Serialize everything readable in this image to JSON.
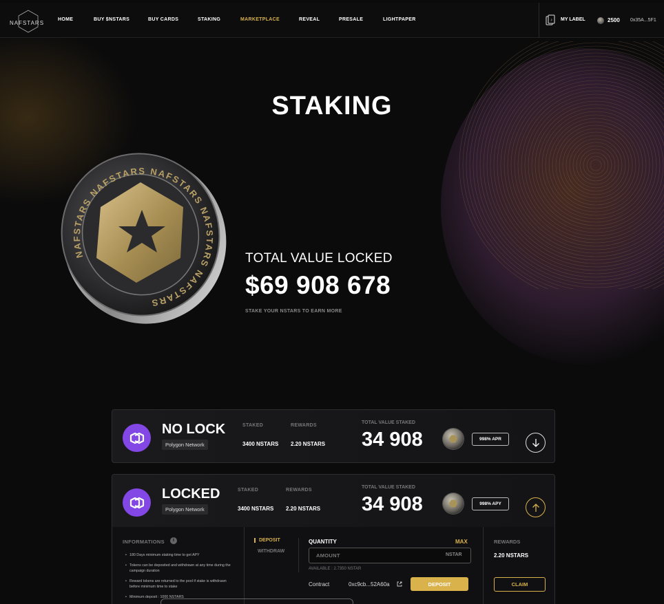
{
  "brand": {
    "logo_text": "NAFSTARS"
  },
  "nav": {
    "items": [
      "HOME",
      "BUY $NSTARS",
      "BUY CARDS",
      "STAKING",
      "MARKETPLACE",
      "REVEAL",
      "PRESALE",
      "LIGHTPAPER"
    ],
    "active": "MARKETPLACE",
    "my_label": "MY LABEL",
    "balance": "2500",
    "wallet": "0x35A...5F1"
  },
  "hero": {
    "title": "STAKING",
    "tvl_label": "TOTAL VALUE LOCKED",
    "tvl_value": "$69 908 678",
    "subtitle": "STAKE YOUR NSTARS TO EARN MORE"
  },
  "pools": [
    {
      "name": "NO LOCK",
      "network": "Polygon Network",
      "staked_label": "STAKED",
      "staked": "3400 NSTARS",
      "rewards_label": "REWARDS",
      "rewards": "2.20  NSTARS",
      "tvs_label": "TOTAL VALUE STAKED",
      "tvs": "34 908",
      "apr": "998% APR",
      "expanded": false
    },
    {
      "name": "LOCKED",
      "network": "Polygon Network",
      "staked_label": "STAKED",
      "staked": "3400 NSTARS",
      "rewards_label": "REWARDS",
      "rewards": "2.20  NSTARS",
      "tvs_label": "TOTAL VALUE STAKED",
      "tvs": "34 908",
      "apr": "998% APY",
      "expanded": true
    }
  ],
  "details": {
    "info_title": "INFORMATIONS",
    "info_items": [
      "180 Days minimum staking time to get APY",
      "Tokens can be deposited and withdrawn at any time during the campaign duration",
      "Reward tokens are returned to the pool if stake is withdrawn before minimum time to stake",
      "Minimum deposit : 1000 NSTARS"
    ],
    "tabs": {
      "deposit": "DEPOSIT",
      "withdraw": "WITHDRAW"
    },
    "quantity_label": "QUANTITY",
    "max_label": "MAX",
    "amount_placeholder": "AMOUNT",
    "amount_unit": "NSTAR",
    "available": "AVAILABLE : 2.7350 NSTAR",
    "contract_label": "Contract",
    "contract_addr": "0xc9cb...52A60a",
    "deposit_button": "DEPOSIT",
    "rewards_title": "REWARDS",
    "rewards_value": "2.20  NSTARS",
    "claim_button": "CLAIM"
  },
  "colors": {
    "accent": "#d9b24c",
    "polygon": "#8247e5",
    "background": "#0b0b0c"
  }
}
